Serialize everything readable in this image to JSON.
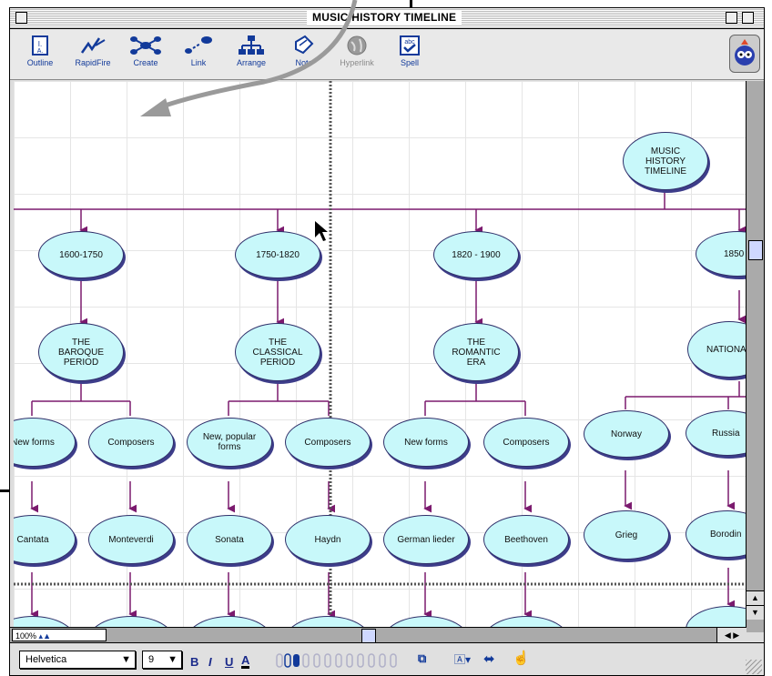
{
  "window": {
    "title": "MUSIC HISTORY TIMELINE"
  },
  "toolbar": {
    "outline": "Outline",
    "rapidfire": "RapidFire",
    "create": "Create",
    "link": "Link",
    "arrange": "Arrange",
    "note": "Note",
    "hyperlink": "Hyperlink",
    "spell": "Spell"
  },
  "diagram": {
    "root": "MUSIC HISTORY TIMELINE",
    "eras": [
      {
        "dates": "1600-1750",
        "period": "THE BAROQUE PERIOD",
        "children": [
          "New forms",
          "Composers"
        ],
        "leaves": [
          "Cantata",
          "Monteverdi"
        ]
      },
      {
        "dates": "1750-1820",
        "period": "THE CLASSICAL PERIOD",
        "children": [
          "New, popular forms",
          "Composers"
        ],
        "leaves": [
          "Sonata",
          "Haydn"
        ]
      },
      {
        "dates": "1820 - 1900",
        "period": "THE ROMANTIC ERA",
        "children": [
          "New forms",
          "Composers"
        ],
        "leaves": [
          "German lieder",
          "Beethoven"
        ]
      },
      {
        "dates": "1850",
        "period": "NATIONA",
        "children": [
          "Norway",
          "Russia"
        ],
        "leaves": [
          "Grieg",
          "Borodin"
        ]
      }
    ]
  },
  "statusbar": {
    "zoom": "100%"
  },
  "format": {
    "font": "Helvetica",
    "size": "9",
    "bold": "B",
    "italic": "I",
    "underline": "U",
    "color": "A"
  },
  "colors": {
    "node_fill": "#c8f8fa",
    "connector": "#7b1a6e",
    "toolbar_text": "#123a9a"
  }
}
